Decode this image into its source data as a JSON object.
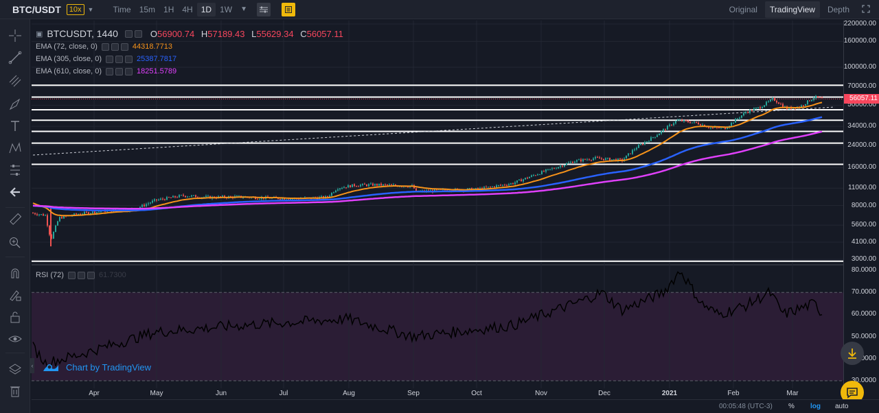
{
  "topbar": {
    "symbol": "BTC/USDT",
    "leverage": "10x",
    "timeframes": [
      "Time",
      "15m",
      "1H",
      "4H",
      "1D",
      "1W"
    ],
    "active_timeframe": "1D",
    "views": [
      "Original",
      "TradingView",
      "Depth"
    ],
    "active_view": "TradingView"
  },
  "legend": {
    "title": "BTCUSDT, 1440",
    "open_label": "O",
    "open": "56900.74",
    "high_label": "H",
    "high": "57189.43",
    "low_label": "L",
    "low": "55629.34",
    "close_label": "C",
    "close": "56057.11",
    "ema72_label": "EMA (72, close, 0)",
    "ema72_value": "44318.7713",
    "ema72_color": "#f7931a",
    "ema305_label": "EMA (305, close, 0)",
    "ema305_value": "25387.7817",
    "ema305_color": "#2962ff",
    "ema610_label": "EMA (610, close, 0)",
    "ema610_value": "18251.5789",
    "ema610_color": "#e040fb",
    "rsi_label": "RSI (72)",
    "rsi_value": "61.7300"
  },
  "watermark": "Chart by TradingView",
  "bottom": {
    "time": "00:05:48 (UTC-3)",
    "pct": "%",
    "log": "log",
    "auto": "auto"
  },
  "chart_data": {
    "type": "candlestick",
    "price_scale": "log",
    "price_ticks": [
      "220000.00",
      "160000.00",
      "100000.00",
      "70000.00",
      "50000.00",
      "34000.00",
      "24000.00",
      "16000.00",
      "11000.00",
      "8000.00",
      "5600.00",
      "4100.00",
      "3000.00"
    ],
    "last_price": "56057.11",
    "rsi_ticks": [
      "80.0000",
      "70.0000",
      "60.0000",
      "50.0000",
      "40.0000",
      "30.0000"
    ],
    "time_ticks": [
      "Apr",
      "May",
      "Jun",
      "Jul",
      "Aug",
      "Sep",
      "Oct",
      "Nov",
      "Dec",
      "2021",
      "Feb",
      "Mar"
    ],
    "horizontal_levels": [
      72000,
      58000,
      46000,
      38000,
      31000,
      25000,
      17000,
      2900
    ],
    "colors": {
      "up": "#26a69a",
      "down": "#ef5350",
      "level": "#ffffff",
      "last": "#f6465d",
      "rsi": "#000000",
      "rsi_band": "#2b1d35"
    }
  }
}
